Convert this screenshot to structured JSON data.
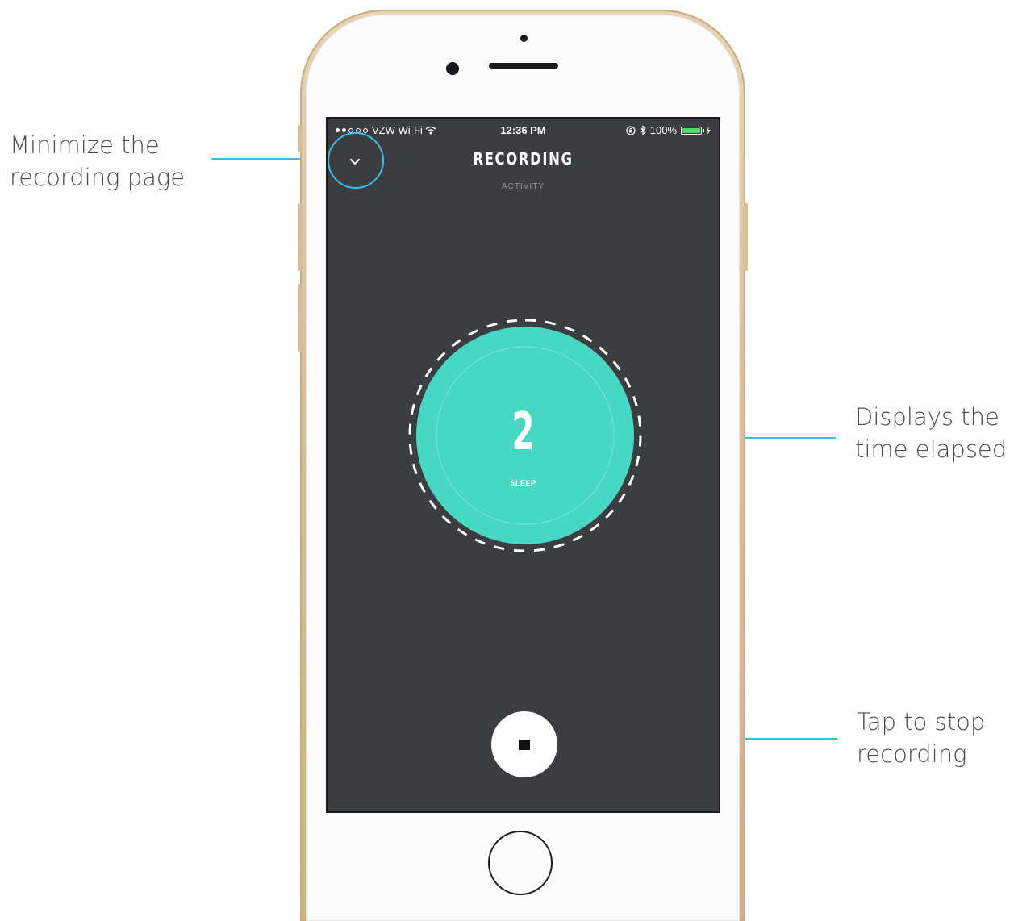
{
  "annotations": {
    "minimize": "Minimize the\nrecording page",
    "elapsed": "Displays the\ntime elapsed",
    "stop": "Tap to stop\nrecording"
  },
  "status_bar": {
    "carrier": "VZW Wi-Fi",
    "time": "12:36 PM",
    "battery_percent": "100%",
    "battery_level": 1.0
  },
  "header": {
    "title": "RECORDING",
    "subtitle": "ACTIVITY"
  },
  "timer": {
    "value": "2",
    "label": "SLEEP",
    "accent_color": "#47d8c3"
  },
  "icons": {
    "minimize": "chevron-down-icon",
    "stop": "stop-icon",
    "wifi": "wifi-icon",
    "bluetooth": "bluetooth-icon",
    "rotation_lock": "rotation-lock-icon",
    "charging": "charging-bolt-icon"
  },
  "colors": {
    "screen_background": "#3b3d41",
    "callout_line": "#35bfe0",
    "phone_frame": "#d9c09b"
  }
}
